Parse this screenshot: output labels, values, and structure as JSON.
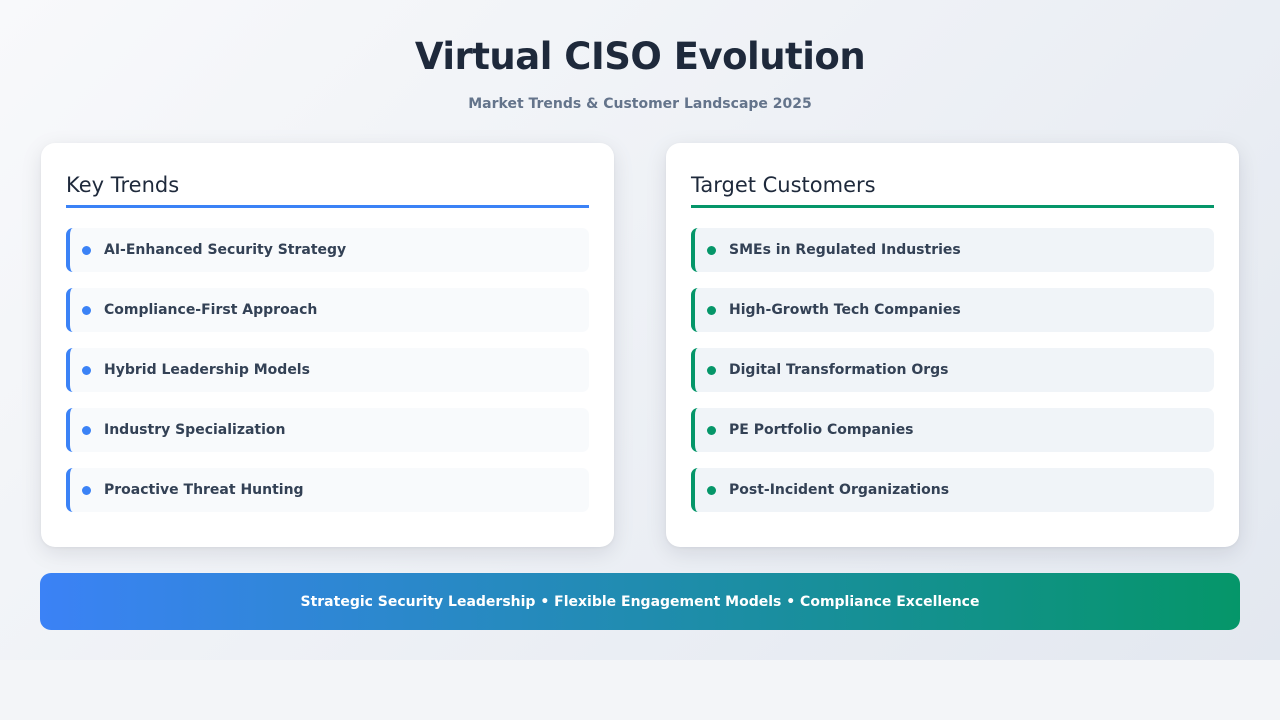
{
  "header": {
    "title": "Virtual CISO Evolution",
    "subtitle": "Market Trends & Customer Landscape 2025"
  },
  "trends": {
    "title": "Key Trends",
    "accent": "#3b82f6",
    "items": [
      {
        "label": "AI-Enhanced Security Strategy"
      },
      {
        "label": "Compliance-First Approach"
      },
      {
        "label": "Hybrid Leadership Models"
      },
      {
        "label": "Industry Specialization"
      },
      {
        "label": "Proactive Threat Hunting"
      }
    ]
  },
  "customers": {
    "title": "Target Customers",
    "accent": "#059669",
    "items": [
      {
        "label": "SMEs in Regulated Industries"
      },
      {
        "label": "High-Growth Tech Companies"
      },
      {
        "label": "Digital Transformation Orgs"
      },
      {
        "label": "PE Portfolio Companies"
      },
      {
        "label": "Post-Incident Organizations"
      }
    ]
  },
  "banner": {
    "text": "Strategic Security Leadership • Flexible Engagement Models • Compliance Excellence",
    "gradient_start": "#3b82f6",
    "gradient_end": "#059669"
  }
}
